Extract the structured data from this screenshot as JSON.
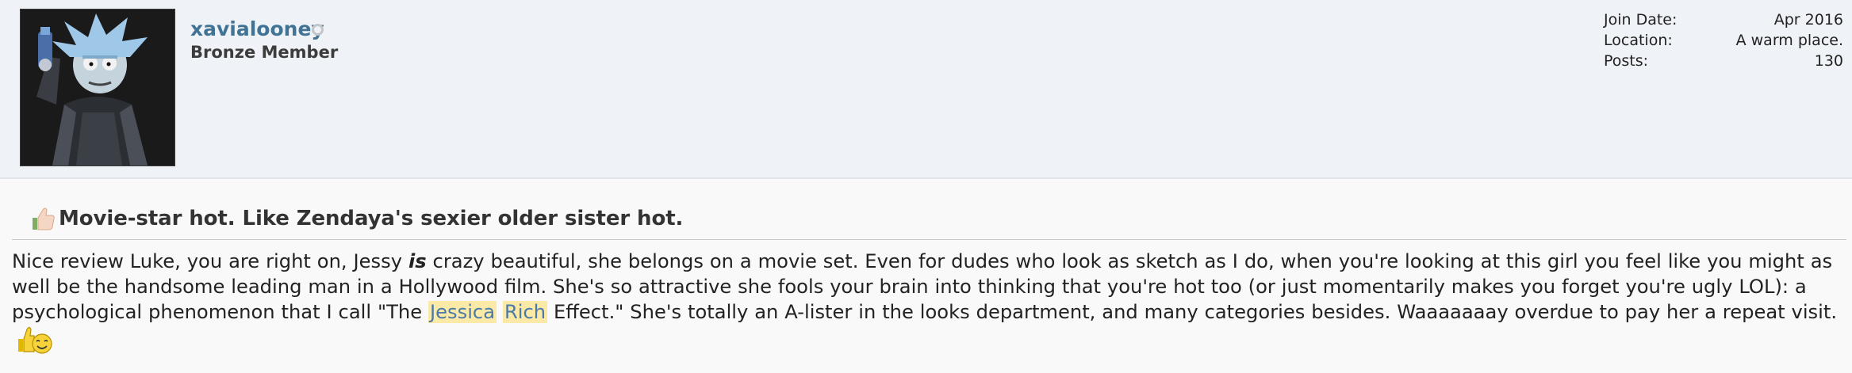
{
  "user": {
    "name": "xavialooney",
    "title": "Bronze Member",
    "avatar_icon": "rick-avatar-icon",
    "status": "offline"
  },
  "stats": [
    {
      "label": "Join Date:",
      "value": "Apr 2016"
    },
    {
      "label": "Location:",
      "value": "A warm place."
    },
    {
      "label": "Posts:",
      "value": "130"
    }
  ],
  "post": {
    "title_icon": "thumbs-up-icon",
    "title": "Movie-star hot. Like Zendaya's sexier older sister hot.",
    "body": {
      "p1": "Nice review Luke, you are right on, Jessy ",
      "em": "is",
      "p2": " crazy beautiful, she belongs on a movie set. Even for dudes who look as sketch as I do, when you're looking at this girl you feel like you might as well be the handsome leading man in a Hollywood film. She's so attractive she fools your brain into thinking that you're hot too (or just momentarily makes you forget you're ugly LOL): a psychological phenomenon that I call \"The ",
      "hl1": "Jessica",
      "hl2": "Rich",
      "p3": " Effect.\" She's totally an A-lister in the looks department, and many categories besides. Waaaaaaay overdue to pay her a repeat visit.",
      "emoji": "thumbs-up-smiley-icon"
    }
  },
  "colors": {
    "username": "#417394",
    "highlight_bg": "#fbe9a7",
    "highlight_text": "#4a7aa6",
    "header_bg": "#eff2f6"
  }
}
